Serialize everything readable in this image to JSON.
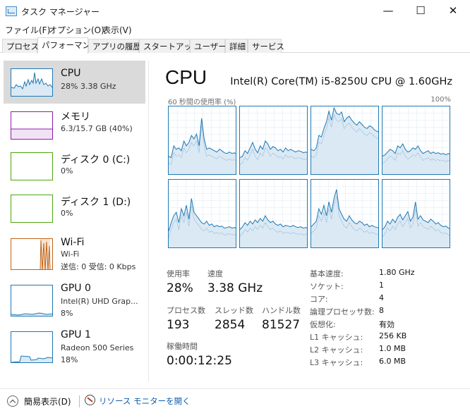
{
  "window": {
    "title": "タスク マネージャー",
    "minimize": "—",
    "maximize": "☐",
    "close": "✕"
  },
  "menu": [
    "ファイル(F)",
    "オプション(O)",
    "表示(V)"
  ],
  "tabs": [
    "プロセス",
    "パフォーマンス",
    "アプリの履歴",
    "スタートアップ",
    "ユーザー",
    "詳細",
    "サービス"
  ],
  "sidebar": [
    {
      "title": "CPU",
      "lines": [
        "28%  3.38 GHz"
      ],
      "color": "#1f78b4"
    },
    {
      "title": "メモリ",
      "lines": [
        "6.3/15.7 GB (40%)"
      ],
      "color": "#8b1fa3"
    },
    {
      "title": "ディスク 0 (C:)",
      "lines": [
        "0%"
      ],
      "color": "#4da60c"
    },
    {
      "title": "ディスク 1 (D:)",
      "lines": [
        "0%"
      ],
      "color": "#4da60c"
    },
    {
      "title": "Wi-Fi",
      "lines": [
        "Wi-Fi",
        "送信: 0  受信: 0 Kbps"
      ],
      "color": "#c0651b"
    },
    {
      "title": "GPU 0",
      "lines": [
        "Intel(R) UHD Grap...",
        "8%"
      ],
      "color": "#1f78b4"
    },
    {
      "title": "GPU 1",
      "lines": [
        "Radeon 500 Series",
        "18%"
      ],
      "color": "#1f78b4"
    }
  ],
  "cpu": {
    "title": "CPU",
    "model": "Intel(R) Core(TM) i5-8250U CPU @ 1.60GHz",
    "graph_caption": "60 秒間の使用率 (%)",
    "graph_max": "100%",
    "stats": {
      "utilization_label": "使用率",
      "utilization": "28%",
      "speed_label": "速度",
      "speed": "3.38 GHz",
      "processes_label": "プロセス数",
      "processes": "193",
      "threads_label": "スレッド数",
      "threads": "2854",
      "handles_label": "ハンドル数",
      "handles": "81527",
      "uptime_label": "稼働時間",
      "uptime": "0:00:12:25"
    },
    "specs": [
      {
        "label": "基本速度:",
        "value": "1.80 GHz"
      },
      {
        "label": "ソケット:",
        "value": "1"
      },
      {
        "label": "コア:",
        "value": "4"
      },
      {
        "label": "論理プロセッサ数:",
        "value": "8"
      },
      {
        "label": "仮想化:",
        "value": "有効"
      },
      {
        "label": "L1 キャッシュ:",
        "value": "256 KB"
      },
      {
        "label": "L2 キャッシュ:",
        "value": "1.0 MB"
      },
      {
        "label": "L3 キャッシュ:",
        "value": "6.0 MB"
      }
    ]
  },
  "footer": {
    "fewer_details": "簡易表示(D)",
    "resource_monitor": "リソース モニターを開く"
  },
  "colors": {
    "graph_line": "#1f78b4",
    "graph_fill": "#dbe9f4",
    "graph_grid": "#d9e8f3"
  }
}
